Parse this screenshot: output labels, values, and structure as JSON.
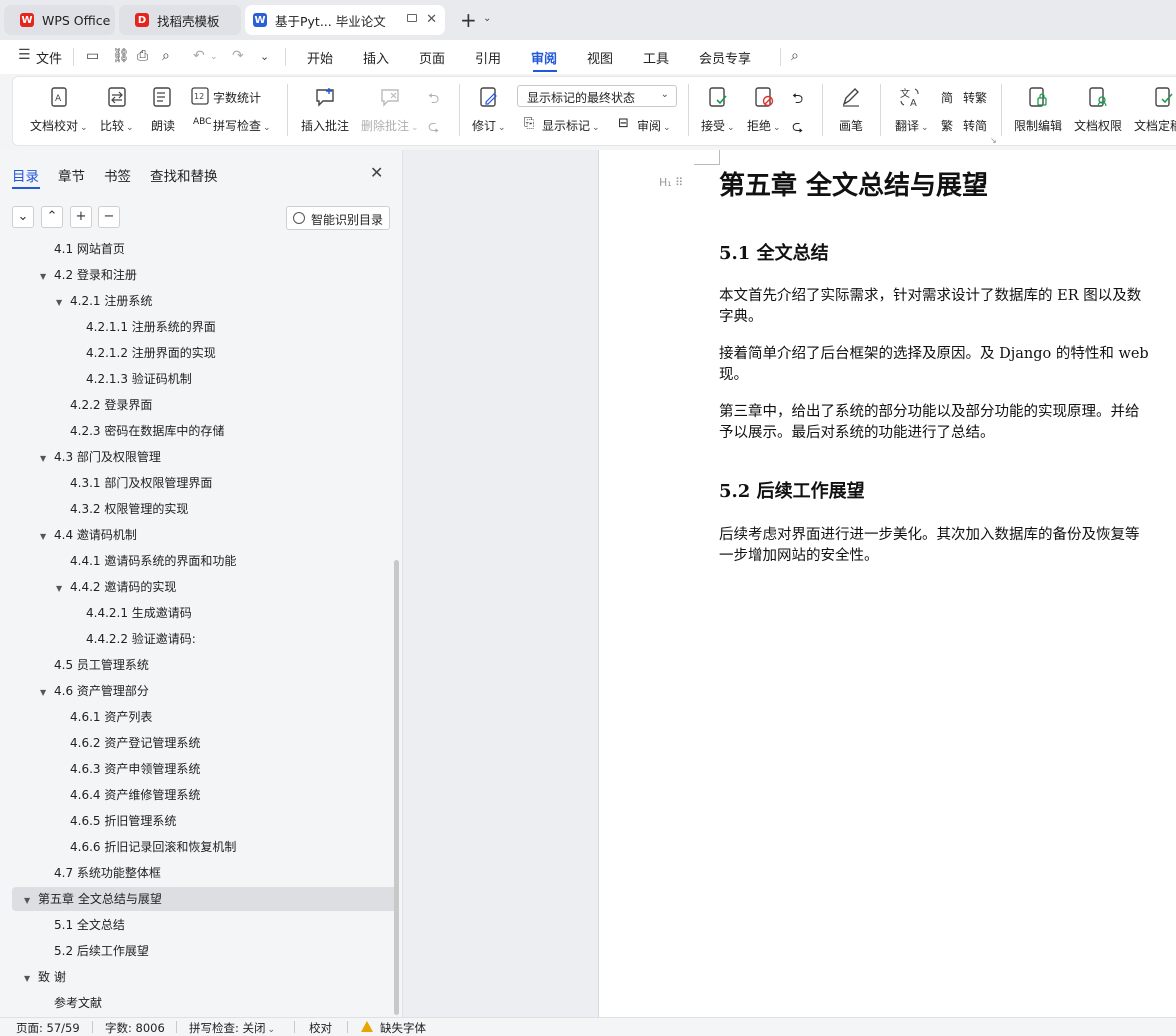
{
  "tabs": [
    {
      "label": "WPS Office",
      "logo": "W",
      "logo_color": "#e5241c"
    },
    {
      "label": "找稻壳模板",
      "logo": "D",
      "logo_color": "#e5241c"
    },
    {
      "label": "基于Pyt... 毕业论文",
      "logo": "W",
      "logo_color": "#2b5fd9"
    }
  ],
  "menu": {
    "file": "文件",
    "items": [
      "开始",
      "插入",
      "页面",
      "引用",
      "审阅",
      "视图",
      "工具",
      "会员专享"
    ],
    "active": "审阅",
    "accent_color": "#2157d9"
  },
  "ribbon": {
    "doc_proof": "文档校对",
    "compare": "比较",
    "read_aloud": "朗读",
    "word_count": "字数统计",
    "spell_check": "拼写检查",
    "insert_comment": "插入批注",
    "delete_comment": "删除批注",
    "track_changes": "修订",
    "markup_view": "显示标记的最终状态",
    "show_markup": "显示标记",
    "review": "审阅",
    "accept": "接受",
    "reject": "拒绝",
    "ink": "画笔",
    "translate": "翻译",
    "to_traditional": "转繁",
    "to_simplified": "转简",
    "restrict_edit": "限制编辑",
    "doc_permission": "文档权限",
    "doc_final": "文档定稿"
  },
  "nav": {
    "tabs": [
      "目录",
      "章节",
      "书签",
      "查找和替换"
    ],
    "smart_toc": "智能识别目录",
    "toc": [
      {
        "label": "4.1 网站首页",
        "indent": 55,
        "tri": ""
      },
      {
        "label": "4.2 登录和注册",
        "indent": 55,
        "tri": "▼"
      },
      {
        "label": "4.2.1 注册系统",
        "indent": 71,
        "tri": "▼"
      },
      {
        "label": "4.2.1.1 注册系统的界面",
        "indent": 87,
        "tri": ""
      },
      {
        "label": "4.2.1.2 注册界面的实现",
        "indent": 87,
        "tri": ""
      },
      {
        "label": "4.2.1.3 验证码机制",
        "indent": 87,
        "tri": ""
      },
      {
        "label": "4.2.2 登录界面",
        "indent": 71,
        "tri": ""
      },
      {
        "label": "4.2.3 密码在数据库中的存储",
        "indent": 71,
        "tri": ""
      },
      {
        "label": "4.3 部门及权限管理",
        "indent": 55,
        "tri": "▼"
      },
      {
        "label": "4.3.1 部门及权限管理界面",
        "indent": 71,
        "tri": ""
      },
      {
        "label": "4.3.2 权限管理的实现",
        "indent": 71,
        "tri": ""
      },
      {
        "label": "4.4 邀请码机制",
        "indent": 55,
        "tri": "▼"
      },
      {
        "label": "4.4.1 邀请码系统的界面和功能",
        "indent": 71,
        "tri": ""
      },
      {
        "label": "4.4.2 邀请码的实现",
        "indent": 71,
        "tri": "▼"
      },
      {
        "label": "4.4.2.1 生成邀请码",
        "indent": 87,
        "tri": ""
      },
      {
        "label": "4.4.2.2 验证邀请码:",
        "indent": 87,
        "tri": ""
      },
      {
        "label": "4.5 员工管理系统",
        "indent": 55,
        "tri": ""
      },
      {
        "label": "4.6 资产管理部分",
        "indent": 55,
        "tri": "▼"
      },
      {
        "label": "4.6.1 资产列表",
        "indent": 71,
        "tri": ""
      },
      {
        "label": "4.6.2 资产登记管理系统",
        "indent": 71,
        "tri": ""
      },
      {
        "label": "4.6.3 资产申领管理系统",
        "indent": 71,
        "tri": ""
      },
      {
        "label": "4.6.4 资产维修管理系统",
        "indent": 71,
        "tri": ""
      },
      {
        "label": "4.6.5 折旧管理系统",
        "indent": 71,
        "tri": ""
      },
      {
        "label": "4.6.6 折旧记录回滚和恢复机制",
        "indent": 71,
        "tri": ""
      },
      {
        "label": "4.7 系统功能整体框",
        "indent": 55,
        "tri": ""
      },
      {
        "label": "第五章 全文总结与展望",
        "indent": 39,
        "tri": "▼",
        "selected": true
      },
      {
        "label": "5.1 全文总结",
        "indent": 55,
        "tri": ""
      },
      {
        "label": "5.2 后续工作展望",
        "indent": 55,
        "tri": ""
      },
      {
        "label": "致 谢",
        "indent": 39,
        "tri": "▼"
      },
      {
        "label": "参考文献",
        "indent": 55,
        "tri": ""
      }
    ]
  },
  "document": {
    "chapter_title": "第五章  全文总结与展望",
    "section1_title": "5.1  全文总结",
    "para1": [
      "本文首先介绍了实际需求，针对需求设计了数据库的 ER 图以及数",
      "字典。"
    ],
    "para2": [
      "接着简单介绍了后台框架的选择及原因。及 Django 的特性和 web",
      "现。"
    ],
    "para3": [
      "第三章中，给出了系统的部分功能以及部分功能的实现原理。并给",
      "予以展示。最后对系统的功能进行了总结。"
    ],
    "section2_title": "5.2  后续工作展望",
    "para4": [
      "后续考虑对界面进行进一步美化。其次加入数据库的备份及恢复等",
      "一步增加网站的安全性。"
    ]
  },
  "status": {
    "page": "页面: 57/59",
    "words": "字数: 8006",
    "spell": "拼写检查: 关闭",
    "proof": "校对",
    "missing_font": "缺失字体"
  }
}
